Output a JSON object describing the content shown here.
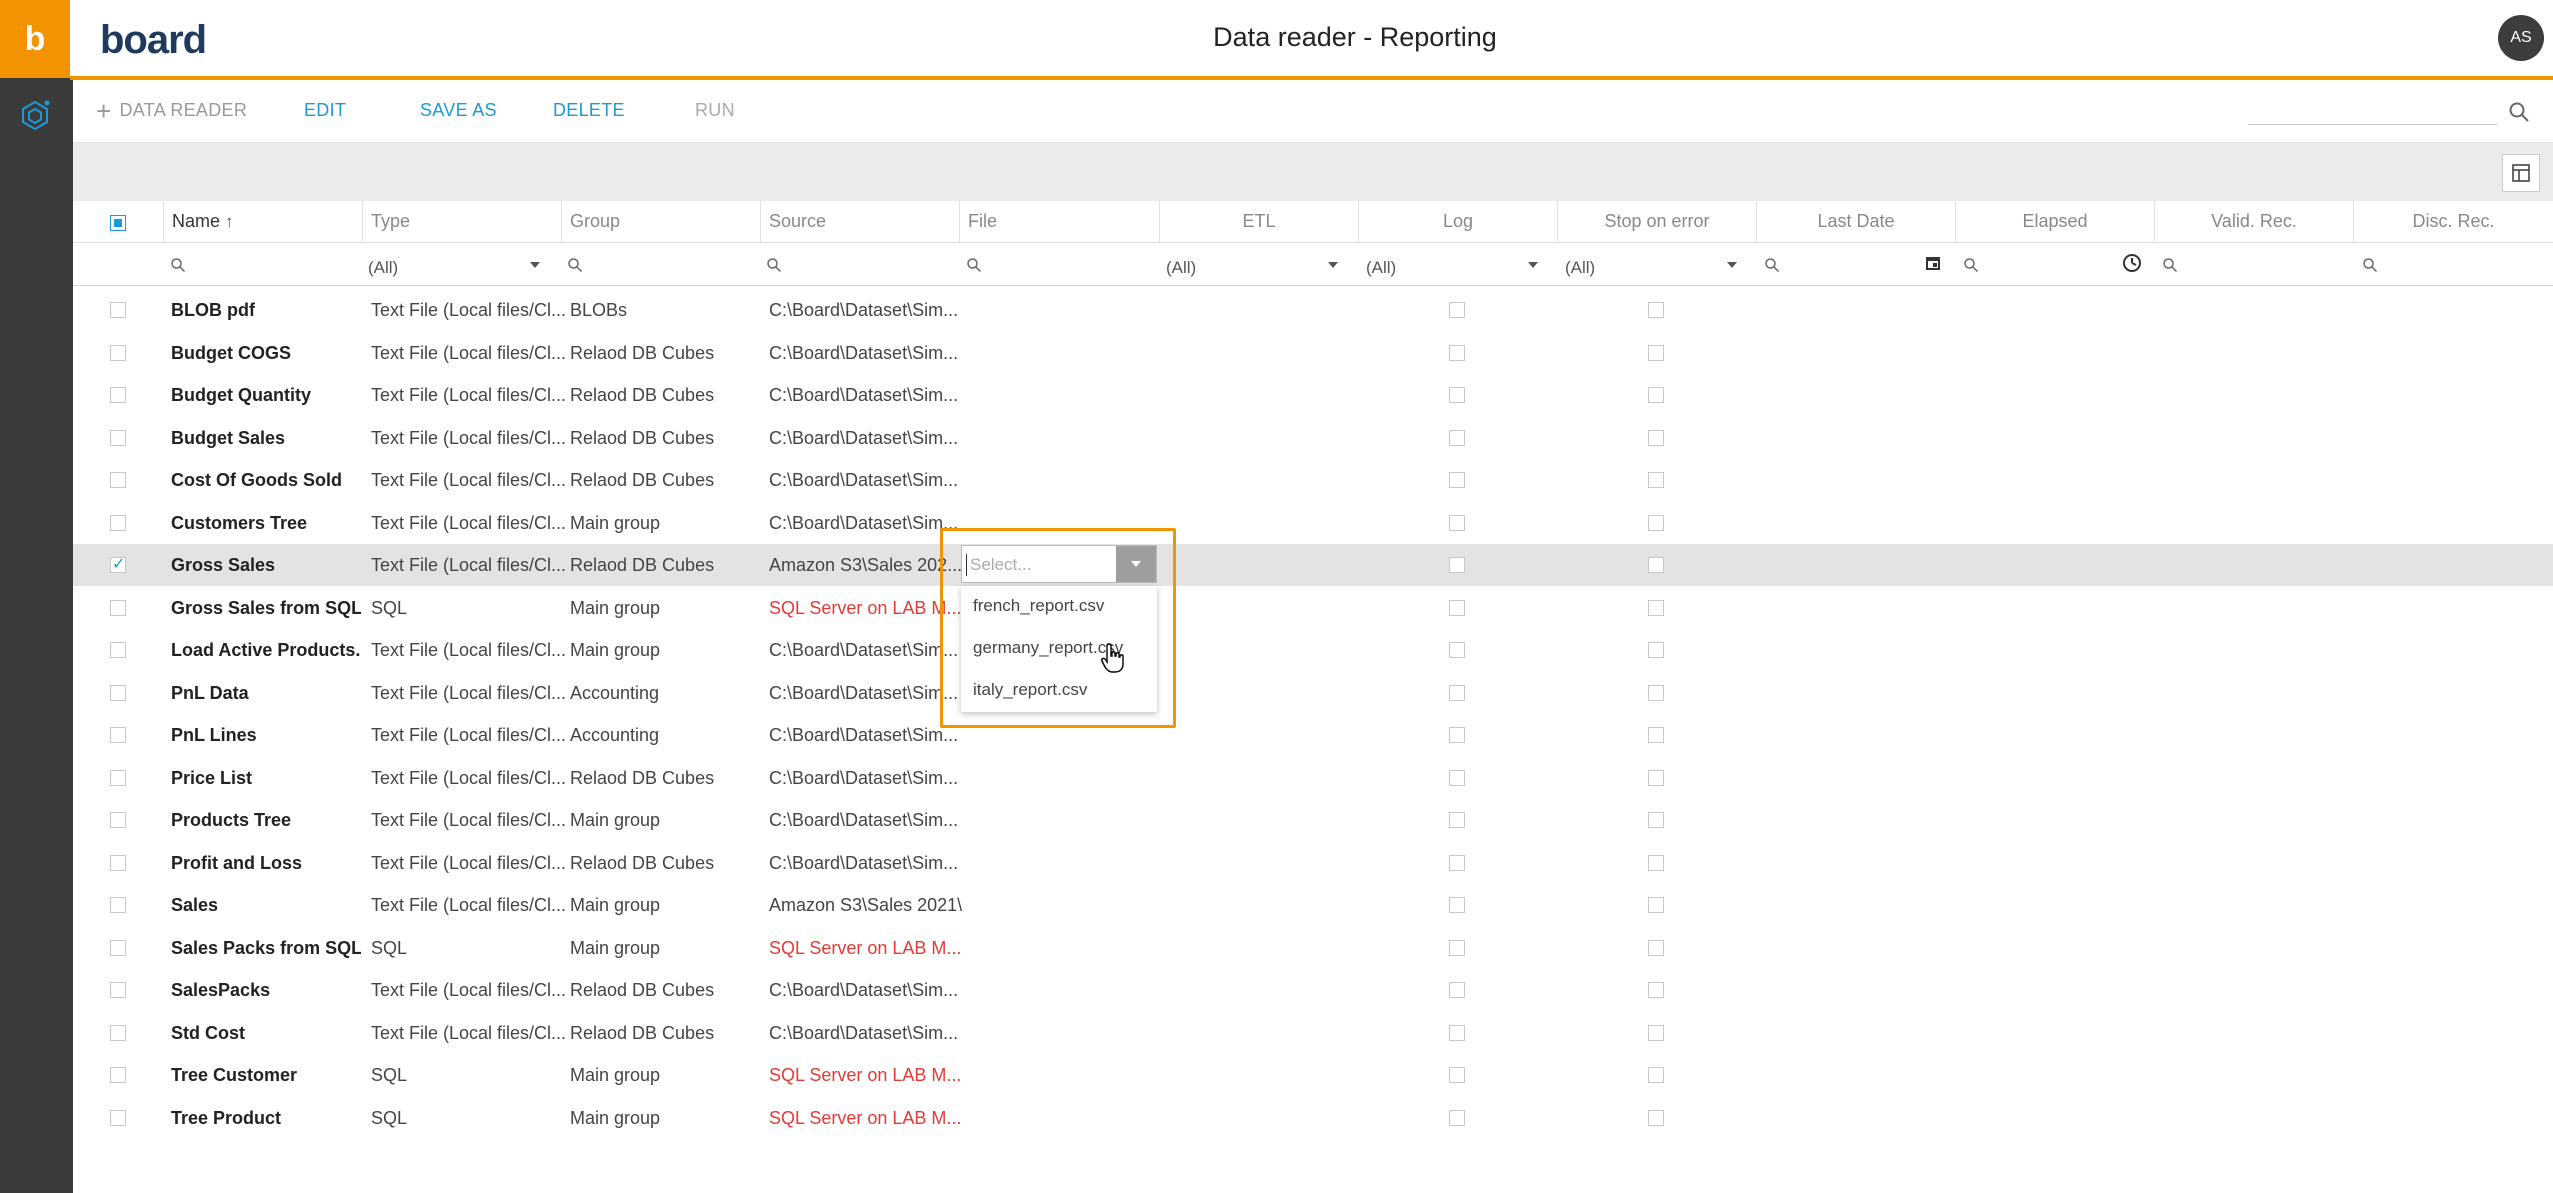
{
  "app": {
    "brand": "board",
    "logo_letter": "b",
    "title": "Data reader - Reporting",
    "avatar_initials": "AS"
  },
  "toolbar": {
    "add_label": "DATA READER",
    "edit_label": "EDIT",
    "save_as_label": "SAVE AS",
    "delete_label": "DELETE",
    "run_label": "RUN"
  },
  "columns": {
    "name": "Name",
    "type": "Type",
    "group": "Group",
    "source": "Source",
    "file": "File",
    "etl": "ETL",
    "log": "Log",
    "stop_on_error": "Stop on error",
    "last_date": "Last Date",
    "elapsed": "Elapsed",
    "valid_rec": "Valid. Rec.",
    "disc_rec": "Disc. Rec."
  },
  "filters": {
    "type": "(All)",
    "etl": "(All)",
    "log": "(All)",
    "stop_on_error": "(All)"
  },
  "rows": [
    {
      "name": "BLOB pdf",
      "type": "Text File (Local files/Cl...",
      "group": "BLOBs",
      "source": "C:\\Board\\Dataset\\Sim...",
      "source_color": "normal"
    },
    {
      "name": "Budget COGS",
      "type": "Text File (Local files/Cl...",
      "group": "Relaod DB Cubes",
      "source": "C:\\Board\\Dataset\\Sim...",
      "source_color": "normal"
    },
    {
      "name": "Budget Quantity",
      "type": "Text File (Local files/Cl...",
      "group": "Relaod DB Cubes",
      "source": "C:\\Board\\Dataset\\Sim...",
      "source_color": "normal"
    },
    {
      "name": "Budget Sales",
      "type": "Text File (Local files/Cl...",
      "group": "Relaod DB Cubes",
      "source": "C:\\Board\\Dataset\\Sim...",
      "source_color": "normal"
    },
    {
      "name": "Cost Of Goods Sold",
      "type": "Text File (Local files/Cl...",
      "group": "Relaod DB Cubes",
      "source": "C:\\Board\\Dataset\\Sim...",
      "source_color": "normal"
    },
    {
      "name": "Customers Tree",
      "type": "Text File (Local files/Cl...",
      "group": "Main group",
      "source": "C:\\Board\\Dataset\\Sim...",
      "source_color": "normal"
    },
    {
      "name": "Gross Sales",
      "type": "Text File (Local files/Cl...",
      "group": "Relaod DB Cubes",
      "source": "Amazon S3\\Sales 202...",
      "source_color": "normal",
      "selected": true
    },
    {
      "name": "Gross Sales from SQL",
      "type": "SQL",
      "group": "Main group",
      "source": "SQL Server on LAB M...",
      "source_color": "red"
    },
    {
      "name": "Load Active Products...",
      "type": "Text File (Local files/Cl...",
      "group": "Main group",
      "source": "C:\\Board\\Dataset\\Sim...",
      "source_color": "normal"
    },
    {
      "name": "PnL Data",
      "type": "Text File (Local files/Cl...",
      "group": "Accounting",
      "source": "C:\\Board\\Dataset\\Sim...",
      "source_color": "normal"
    },
    {
      "name": "PnL Lines",
      "type": "Text File (Local files/Cl...",
      "group": "Accounting",
      "source": "C:\\Board\\Dataset\\Sim...",
      "source_color": "normal"
    },
    {
      "name": "Price List",
      "type": "Text File (Local files/Cl...",
      "group": "Relaod DB Cubes",
      "source": "C:\\Board\\Dataset\\Sim...",
      "source_color": "normal"
    },
    {
      "name": "Products Tree",
      "type": "Text File (Local files/Cl...",
      "group": "Main group",
      "source": "C:\\Board\\Dataset\\Sim...",
      "source_color": "normal"
    },
    {
      "name": "Profit and Loss",
      "type": "Text File (Local files/Cl...",
      "group": "Relaod DB Cubes",
      "source": "C:\\Board\\Dataset\\Sim...",
      "source_color": "normal"
    },
    {
      "name": "Sales",
      "type": "Text File (Local files/Cl...",
      "group": "Main group",
      "source": "Amazon S3\\Sales 2021\\",
      "source_color": "normal"
    },
    {
      "name": "Sales Packs from SQL",
      "type": "SQL",
      "group": "Main group",
      "source": "SQL Server on LAB M...",
      "source_color": "red"
    },
    {
      "name": "SalesPacks",
      "type": "Text File (Local files/Cl...",
      "group": "Relaod DB Cubes",
      "source": "C:\\Board\\Dataset\\Sim...",
      "source_color": "normal"
    },
    {
      "name": "Std Cost",
      "type": "Text File (Local files/Cl...",
      "group": "Relaod DB Cubes",
      "source": "C:\\Board\\Dataset\\Sim...",
      "source_color": "normal"
    },
    {
      "name": "Tree Customer",
      "type": "SQL",
      "group": "Main group",
      "source": "SQL Server on LAB M...",
      "source_color": "red"
    },
    {
      "name": "Tree Product",
      "type": "SQL",
      "group": "Main group",
      "source": "SQL Server on LAB M...",
      "source_color": "red"
    }
  ],
  "file_dropdown": {
    "placeholder": "Select...",
    "options": [
      "french_report.csv",
      "germany_report.csv",
      "italy_report.csv"
    ]
  },
  "icons": {
    "logo": "board-logo-icon",
    "rail": "data-model-icon",
    "search": "search-icon",
    "grid": "table-settings-icon",
    "sort": "sort-ascending-icon",
    "calendar": "calendar-icon",
    "clock": "clock-icon",
    "cursor": "hand-pointer-icon"
  },
  "colors": {
    "accent": "#f29400",
    "link": "#1b9ad7",
    "error_source": "#e53935",
    "rail": "#3b3b3b"
  }
}
